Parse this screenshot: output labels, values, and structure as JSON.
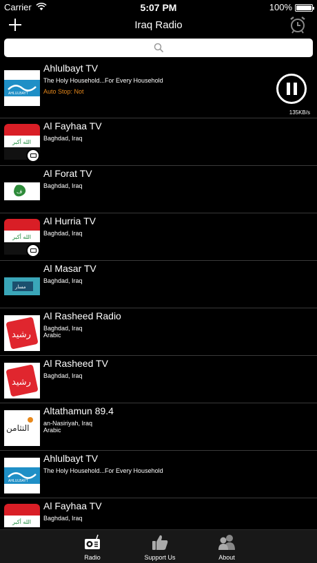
{
  "status": {
    "carrier": "Carrier",
    "time": "5:07 PM",
    "battery": "100%"
  },
  "nav": {
    "title": "Iraq Radio",
    "add_icon": "plus-icon",
    "alarm_icon": "alarm-clock-icon"
  },
  "search": {
    "placeholder": "",
    "icon": "search-icon"
  },
  "stations": [
    {
      "name": "Ahlulbayt TV",
      "line1": "The Holy Household...For Every Household",
      "line2": "",
      "auto_stop": "Auto Stop: Not",
      "speed": "135KB/s",
      "logo": "ahlulbayt-logo",
      "playing": true
    },
    {
      "name": "Al Fayhaa TV",
      "line1": "Baghdad, Iraq",
      "line2": "",
      "logo": "iraq-flag-logo",
      "badge": true
    },
    {
      "name": "Al Forat TV",
      "line1": "Baghdad, Iraq",
      "line2": "",
      "logo": "alforat-logo"
    },
    {
      "name": "Al Hurria TV",
      "line1": "Baghdad, Iraq",
      "line2": "",
      "logo": "iraq-flag-logo",
      "badge": true
    },
    {
      "name": "Al Masar TV",
      "line1": "Baghdad, Iraq",
      "line2": "",
      "logo": "almasar-logo"
    },
    {
      "name": "Al Rasheed Radio",
      "line1": "Baghdad, Iraq",
      "line2": "Arabic",
      "logo": "alrasheed-logo"
    },
    {
      "name": "Al Rasheed TV",
      "line1": "Baghdad, Iraq",
      "line2": "",
      "logo": "alrasheed-logo"
    },
    {
      "name": "Altathamun 89.4",
      "line1": "an-Nasiriyah, Iraq",
      "line2": "Arabic",
      "logo": "altathamun-logo"
    },
    {
      "name": "Ahlulbayt TV",
      "line1": "The Holy Household...For Every Household",
      "line2": "",
      "logo": "ahlulbayt-logo"
    },
    {
      "name": "Al Fayhaa TV",
      "line1": "Baghdad, Iraq",
      "line2": "",
      "logo": "iraq-flag-logo",
      "badge": true
    }
  ],
  "tabs": [
    {
      "label": "Radio",
      "icon": "radio-icon"
    },
    {
      "label": "Support Us",
      "icon": "thumbs-up-icon"
    },
    {
      "label": "About",
      "icon": "people-icon"
    }
  ],
  "colors": {
    "background": "#000000",
    "accent": "#e8891c",
    "separator": "#3a3a3a"
  }
}
